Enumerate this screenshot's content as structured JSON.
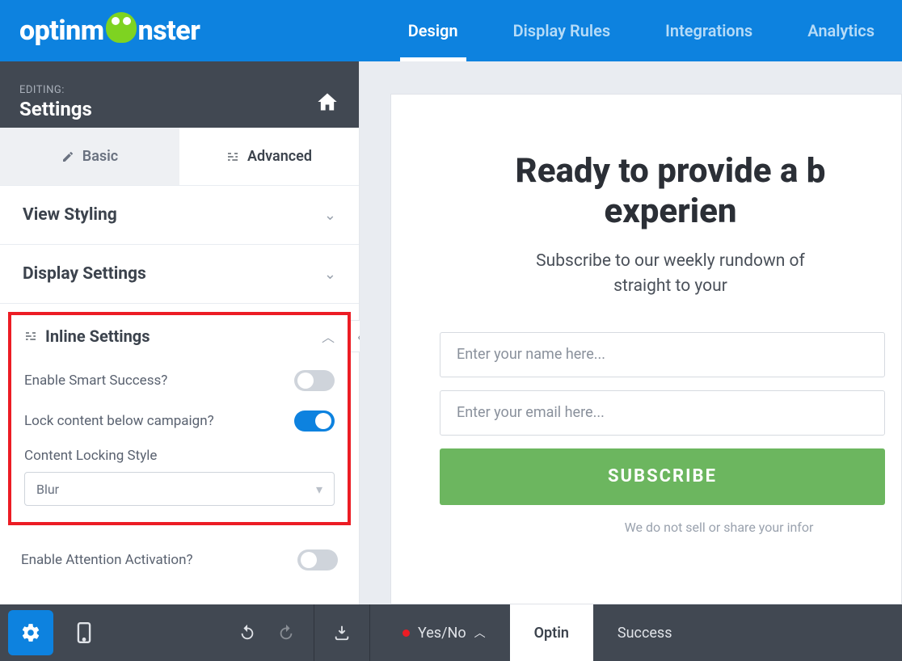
{
  "brand": {
    "name_left": "optinm",
    "name_right": "nster"
  },
  "topnav": {
    "tabs": [
      "Design",
      "Display Rules",
      "Integrations",
      "Analytics"
    ],
    "active": 0
  },
  "side_header": {
    "editing": "EDITING:",
    "title": "Settings"
  },
  "subtabs": {
    "basic": "Basic",
    "advanced": "Advanced",
    "active": "advanced"
  },
  "sections": {
    "view_styling": "View Styling",
    "display_settings": "Display Settings",
    "inline_settings": "Inline Settings"
  },
  "inline": {
    "smart_success": {
      "label": "Enable Smart Success?",
      "value": false
    },
    "lock_content": {
      "label": "Lock content below campaign?",
      "value": true
    },
    "locking_style": {
      "label": "Content Locking Style",
      "value": "Blur"
    },
    "attention": {
      "label": "Enable Attention Activation?",
      "value": false
    }
  },
  "preview": {
    "title_1": "Ready to provide a b",
    "title_2": "experien",
    "sub_1": "Subscribe to our weekly rundown of",
    "sub_2": "straight to your",
    "name_ph": "Enter your name here...",
    "email_ph": "Enter your email here...",
    "cta": "SUBSCRIBE",
    "disclaimer": "We do not sell or share your infor"
  },
  "bottombar": {
    "yesno": "Yes/No",
    "optin": "Optin",
    "success": "Success"
  }
}
